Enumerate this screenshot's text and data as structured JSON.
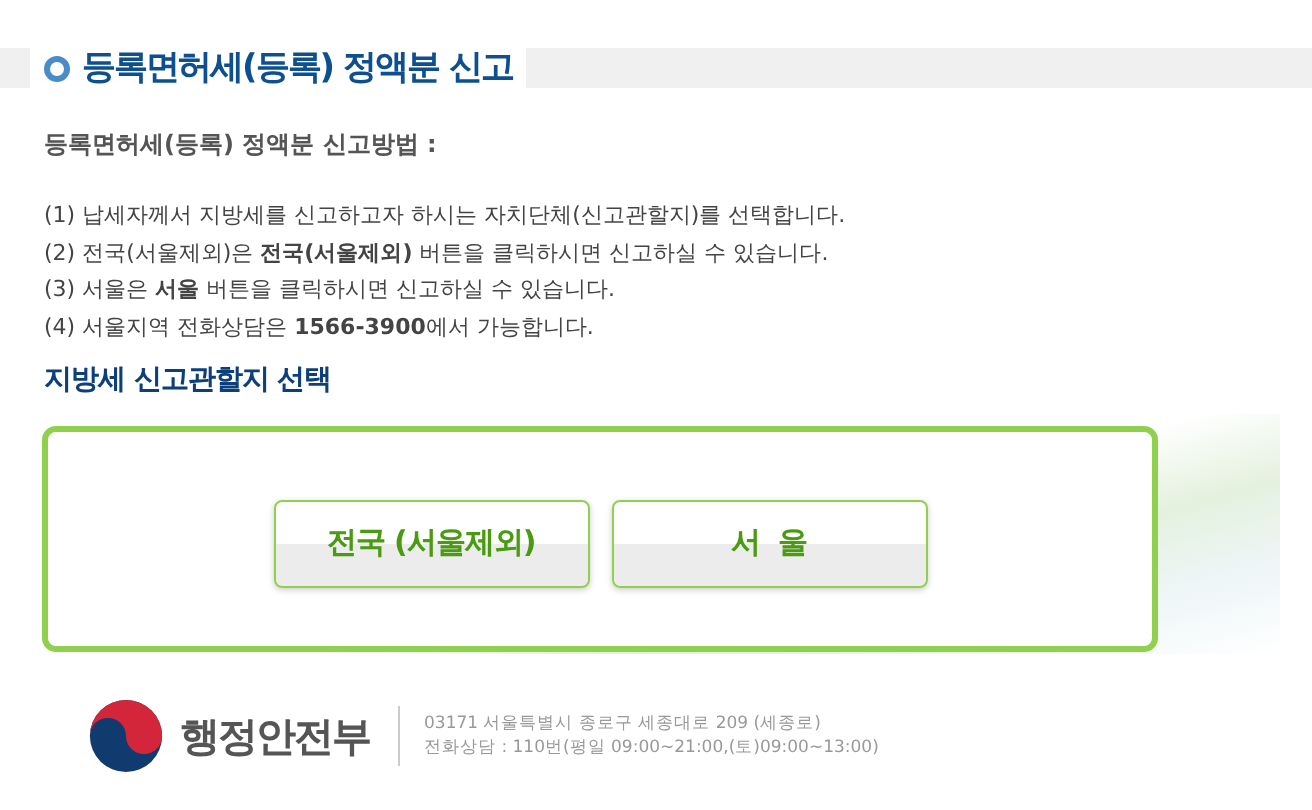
{
  "title": "등록면허세(등록) 정액분 신고",
  "method_heading": "등록면허세(등록) 정액분 신고방법 :",
  "instructions": [
    "(1) 납세자께서 지방세를 신고하고자 하시는 자치단체(신고관할지)를 선택합니다.",
    "(2) 전국(서울제외)은 **전국(서울제외)** 버튼을 클릭하시면 신고하실 수 있습니다.",
    "(3) 서울은 **서울** 버튼을 클릭하시면 신고하실 수 있습니다.",
    "(4) 서울지역 전화상담은 **1566-3900**에서 가능합니다."
  ],
  "section_title": "지방세 신고관할지 선택",
  "buttons": [
    "전국 (서울제외)",
    "서  울"
  ],
  "footer": {
    "ministry": "행정안전부",
    "address": "03171 서울특별시 종로구 세종대로 209 (세종로)",
    "phone": "전화상담 : 110번(평일 09:00~21:00,(토)09:00~13:00)"
  }
}
